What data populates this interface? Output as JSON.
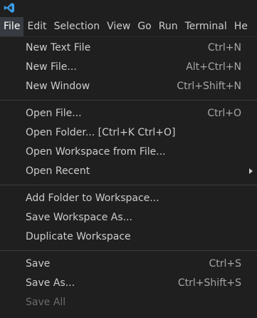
{
  "app": {
    "logo_icon": "vscode-logo-icon",
    "accent_color": "#3c9ee8"
  },
  "menubar": {
    "items": [
      {
        "label": "File",
        "active": true
      },
      {
        "label": "Edit"
      },
      {
        "label": "Selection"
      },
      {
        "label": "View"
      },
      {
        "label": "Go"
      },
      {
        "label": "Run"
      },
      {
        "label": "Terminal"
      },
      {
        "label": "He"
      }
    ]
  },
  "file_menu": {
    "groups": [
      [
        {
          "label": "New Text File",
          "shortcut": "Ctrl+N"
        },
        {
          "label": "New File...",
          "shortcut": "Alt+Ctrl+N"
        },
        {
          "label": "New Window",
          "shortcut": "Ctrl+Shift+N"
        }
      ],
      [
        {
          "label": "Open File...",
          "shortcut": "Ctrl+O"
        },
        {
          "label": "Open Folder... [Ctrl+K Ctrl+O]",
          "shortcut": ""
        },
        {
          "label": "Open Workspace from File...",
          "shortcut": ""
        },
        {
          "label": "Open Recent",
          "shortcut": "",
          "submenu_icon": "chevron-right-icon"
        }
      ],
      [
        {
          "label": "Add Folder to Workspace...",
          "shortcut": ""
        },
        {
          "label": "Save Workspace As...",
          "shortcut": ""
        },
        {
          "label": "Duplicate Workspace",
          "shortcut": ""
        }
      ],
      [
        {
          "label": "Save",
          "shortcut": "Ctrl+S"
        },
        {
          "label": "Save As...",
          "shortcut": "Ctrl+Shift+S"
        },
        {
          "label": "Save All",
          "shortcut": "",
          "disabled": true
        }
      ]
    ]
  }
}
